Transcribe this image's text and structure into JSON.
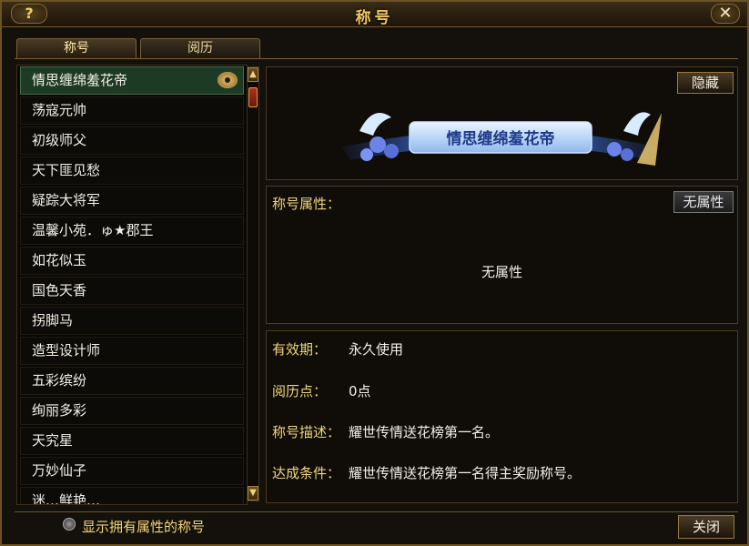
{
  "window": {
    "title": "称号",
    "help_label": "?",
    "close_label": "✕"
  },
  "tabs": [
    {
      "label": "称号",
      "active": true
    },
    {
      "label": "阅历",
      "active": false
    }
  ],
  "title_list": {
    "items": [
      {
        "label": "情思缠绵羞花帝",
        "selected": true
      },
      {
        "label": "荡寇元帅"
      },
      {
        "label": "初级师父"
      },
      {
        "label": "天下匪见愁"
      },
      {
        "label": "疑踪大将军"
      },
      {
        "label": "温馨小苑．ゅ★郡王"
      },
      {
        "label": "如花似玉"
      },
      {
        "label": "国色天香"
      },
      {
        "label": "拐脚马"
      },
      {
        "label": "造型设计师"
      },
      {
        "label": "五彩缤纷"
      },
      {
        "label": "绚丽多彩"
      },
      {
        "label": "天究星"
      },
      {
        "label": "万妙仙子"
      },
      {
        "label": "迷…鲜艳…"
      }
    ],
    "scroll_up": "▲",
    "scroll_down": "▼"
  },
  "preview": {
    "hide_button": "隐藏",
    "banner_text": "情思缠绵羞花帝"
  },
  "attributes": {
    "label": "称号属性：",
    "no_attr_button": "无属性",
    "value": "无属性"
  },
  "info": {
    "validity_key": "有效期：",
    "validity_val": "永久使用",
    "exp_key": "阅历点：",
    "exp_val": "0点",
    "desc_key": "称号描述：",
    "desc_val": "耀世传情送花榜第一名。",
    "cond_key": "达成条件：",
    "cond_val": "耀世传情送花榜第一名得主奖励称号。"
  },
  "footer": {
    "checkbox_label": "显示拥有属性的称号",
    "close_button": "关闭"
  }
}
